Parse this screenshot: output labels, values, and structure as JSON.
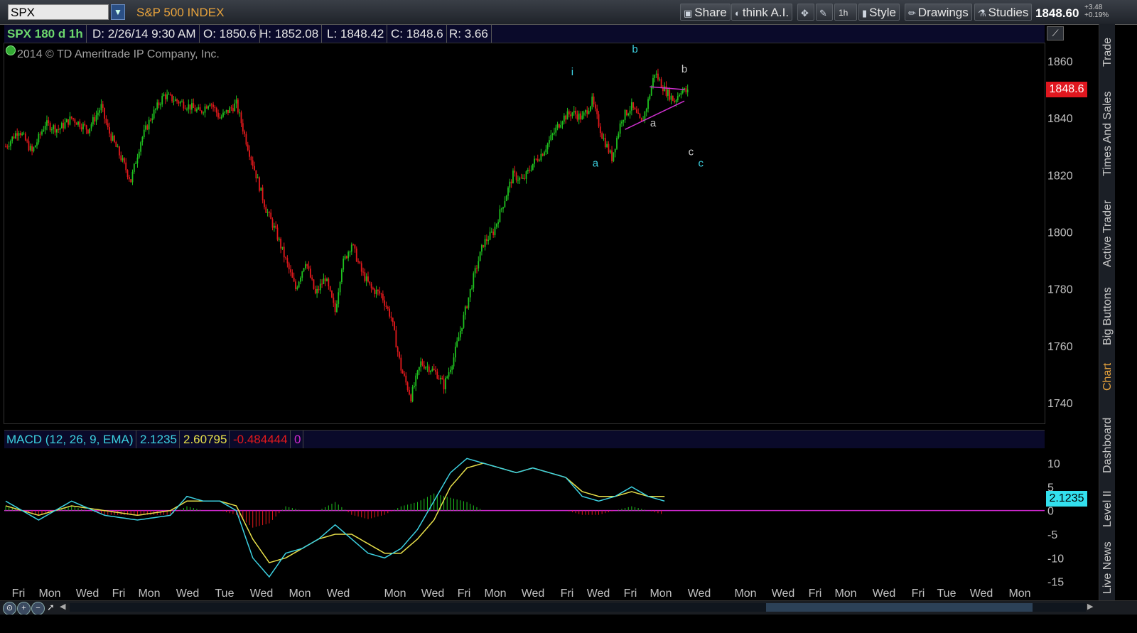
{
  "header": {
    "symbol": "SPX",
    "index_name": "S&P 500 INDEX",
    "buttons": {
      "share": "Share",
      "think_ai": "think A.I.",
      "interval": "1h",
      "style": "Style",
      "drawings": "Drawings",
      "studies": "Studies"
    },
    "last_price": "1848.60",
    "change_abs": "+3.48",
    "change_pct": "+0.19%"
  },
  "infobar": {
    "title": "SPX 180 d 1h",
    "date": "D: 2/26/14 9:30 AM",
    "open": "O: 1850.6",
    "high": "H: 1852.08",
    "low": "L: 1848.42",
    "close": "C: 1848.6",
    "range": "R: 3.66"
  },
  "copyright": "2014 © TD Ameritrade IP Company, Inc.",
  "price_tag": "1848.6",
  "macd_header": {
    "label": "MACD (12, 26, 9, EMA)",
    "value": "2.1235",
    "avg": "2.60795",
    "diff": "-0.484444",
    "zero": "0"
  },
  "macd_tag": "2.1235",
  "right_tabs": [
    "Trade",
    "Times And Sales",
    "Active Trader",
    "Big Buttons",
    "Chart",
    "Dashboard",
    "Level II",
    "Live News"
  ],
  "colors": {
    "up": "#1fc21f",
    "down": "#e3191c",
    "macd_line": "#3cd0e0",
    "signal_line": "#e8e04a",
    "zero_line": "#d028d0",
    "trendline": "#d030d0",
    "axis_text": "#c0c0c0"
  },
  "chart_data": [
    {
      "type": "candlestick",
      "title": "",
      "xlabel": "",
      "ylabel": "",
      "ylim": [
        1733,
        1866
      ],
      "yticks": [
        1740,
        1760,
        1780,
        1800,
        1820,
        1840,
        1860
      ],
      "x_tick_labels": [
        "Fri",
        "Mon",
        "Wed",
        "Fri",
        "Mon",
        "Wed",
        "Tue",
        "Wed",
        "Mon",
        "Wed",
        "Mon",
        "Wed",
        "Fri",
        "Mon",
        "Wed",
        "Fri",
        "Wed",
        "Fri",
        "Mon",
        "Wed",
        "Mon",
        "Wed",
        "Fri",
        "Mon",
        "Wed",
        "Fri",
        "Tue",
        "Wed",
        "Mon"
      ],
      "close_path": [
        [
          0,
          1830
        ],
        [
          8,
          1836
        ],
        [
          16,
          1828
        ],
        [
          24,
          1838
        ],
        [
          32,
          1836
        ],
        [
          40,
          1840
        ],
        [
          50,
          1836
        ],
        [
          58,
          1844
        ],
        [
          62,
          1836
        ],
        [
          70,
          1826
        ],
        [
          76,
          1818
        ],
        [
          82,
          1832
        ],
        [
          88,
          1840
        ],
        [
          96,
          1848
        ],
        [
          104,
          1846
        ],
        [
          112,
          1844
        ],
        [
          118,
          1842
        ],
        [
          124,
          1846
        ],
        [
          130,
          1840
        ],
        [
          136,
          1843
        ],
        [
          140,
          1845
        ],
        [
          146,
          1832
        ],
        [
          152,
          1820
        ],
        [
          158,
          1808
        ],
        [
          164,
          1800
        ],
        [
          170,
          1790
        ],
        [
          176,
          1780
        ],
        [
          182,
          1790
        ],
        [
          188,
          1778
        ],
        [
          194,
          1784
        ],
        [
          200,
          1772
        ],
        [
          204,
          1788
        ],
        [
          210,
          1796
        ],
        [
          216,
          1786
        ],
        [
          222,
          1780
        ],
        [
          228,
          1778
        ],
        [
          234,
          1770
        ],
        [
          240,
          1752
        ],
        [
          246,
          1742
        ],
        [
          252,
          1754
        ],
        [
          258,
          1752
        ],
        [
          262,
          1750
        ],
        [
          266,
          1746
        ],
        [
          272,
          1756
        ],
        [
          278,
          1770
        ],
        [
          284,
          1784
        ],
        [
          290,
          1796
        ],
        [
          296,
          1800
        ],
        [
          302,
          1810
        ],
        [
          308,
          1820
        ],
        [
          314,
          1818
        ],
        [
          320,
          1824
        ],
        [
          326,
          1828
        ],
        [
          332,
          1834
        ],
        [
          338,
          1840
        ],
        [
          344,
          1842
        ],
        [
          350,
          1840
        ],
        [
          356,
          1846
        ],
        [
          362,
          1834
        ],
        [
          368,
          1826
        ],
        [
          374,
          1840
        ],
        [
          380,
          1844
        ],
        [
          386,
          1838
        ],
        [
          390,
          1846
        ],
        [
          394,
          1856
        ],
        [
          400,
          1850
        ],
        [
          406,
          1846
        ],
        [
          410,
          1850
        ],
        [
          414,
          1849
        ]
      ],
      "last_close": 1848.6,
      "candle_count": 415,
      "annotations": [
        {
          "text": "i",
          "x": 344,
          "y": 1855,
          "color": "#3cd0e0"
        },
        {
          "text": "b",
          "x": 382,
          "y": 1863,
          "color": "#3cd0e0"
        },
        {
          "text": "a",
          "x": 358,
          "y": 1823,
          "color": "#3cd0e0"
        },
        {
          "text": "b",
          "x": 412,
          "y": 1856,
          "color": "#c8c8c8"
        },
        {
          "text": "a",
          "x": 393,
          "y": 1837,
          "color": "#c8c8c8"
        },
        {
          "text": "c",
          "x": 416,
          "y": 1827,
          "color": "#c8c8c8"
        },
        {
          "text": "c",
          "x": 422,
          "y": 1823,
          "color": "#3cd0e0"
        }
      ],
      "trendlines": [
        {
          "from": [
            391,
            1851
          ],
          "to": [
            412,
            1850
          ]
        },
        {
          "from": [
            376,
            1836
          ],
          "to": [
            412,
            1846
          ]
        }
      ]
    },
    {
      "type": "line",
      "title": "",
      "ylim": [
        -15.5,
        13
      ],
      "yticks": [
        -15,
        -10,
        -5,
        0,
        5,
        10
      ],
      "series": [
        {
          "name": "",
          "values_path": [
            [
              0,
              2
            ],
            [
              20,
              -2
            ],
            [
              40,
              2
            ],
            [
              60,
              -1
            ],
            [
              80,
              -2
            ],
            [
              100,
              -1
            ],
            [
              110,
              3
            ],
            [
              120,
              2
            ],
            [
              130,
              2
            ],
            [
              140,
              0
            ],
            [
              150,
              -10
            ],
            [
              160,
              -14
            ],
            [
              170,
              -9
            ],
            [
              180,
              -8
            ],
            [
              190,
              -6
            ],
            [
              200,
              -3
            ],
            [
              210,
              -6
            ],
            [
              220,
              -9
            ],
            [
              230,
              -10
            ],
            [
              240,
              -8
            ],
            [
              250,
              -4
            ],
            [
              260,
              2
            ],
            [
              270,
              8
            ],
            [
              280,
              11
            ],
            [
              290,
              10
            ],
            [
              300,
              9
            ],
            [
              310,
              8
            ],
            [
              320,
              9
            ],
            [
              330,
              8
            ],
            [
              340,
              7
            ],
            [
              350,
              3
            ],
            [
              360,
              2
            ],
            [
              370,
              3
            ],
            [
              380,
              5
            ],
            [
              390,
              3
            ],
            [
              400,
              2
            ]
          ]
        },
        {
          "name": "",
          "values_path": [
            [
              0,
              1
            ],
            [
              20,
              -1
            ],
            [
              40,
              1
            ],
            [
              60,
              0
            ],
            [
              80,
              -1
            ],
            [
              100,
              0
            ],
            [
              110,
              2
            ],
            [
              120,
              2
            ],
            [
              130,
              2
            ],
            [
              140,
              1
            ],
            [
              150,
              -6
            ],
            [
              160,
              -11
            ],
            [
              170,
              -10
            ],
            [
              180,
              -8
            ],
            [
              190,
              -6
            ],
            [
              200,
              -5
            ],
            [
              210,
              -5
            ],
            [
              220,
              -7
            ],
            [
              230,
              -9
            ],
            [
              240,
              -9
            ],
            [
              250,
              -6
            ],
            [
              260,
              -2
            ],
            [
              270,
              5
            ],
            [
              280,
              9
            ],
            [
              290,
              10
            ],
            [
              300,
              9
            ],
            [
              310,
              8
            ],
            [
              320,
              9
            ],
            [
              330,
              8
            ],
            [
              340,
              7
            ],
            [
              350,
              4
            ],
            [
              360,
              3
            ],
            [
              370,
              3
            ],
            [
              380,
              4
            ],
            [
              390,
              3
            ],
            [
              400,
              3
            ]
          ]
        }
      ]
    }
  ]
}
